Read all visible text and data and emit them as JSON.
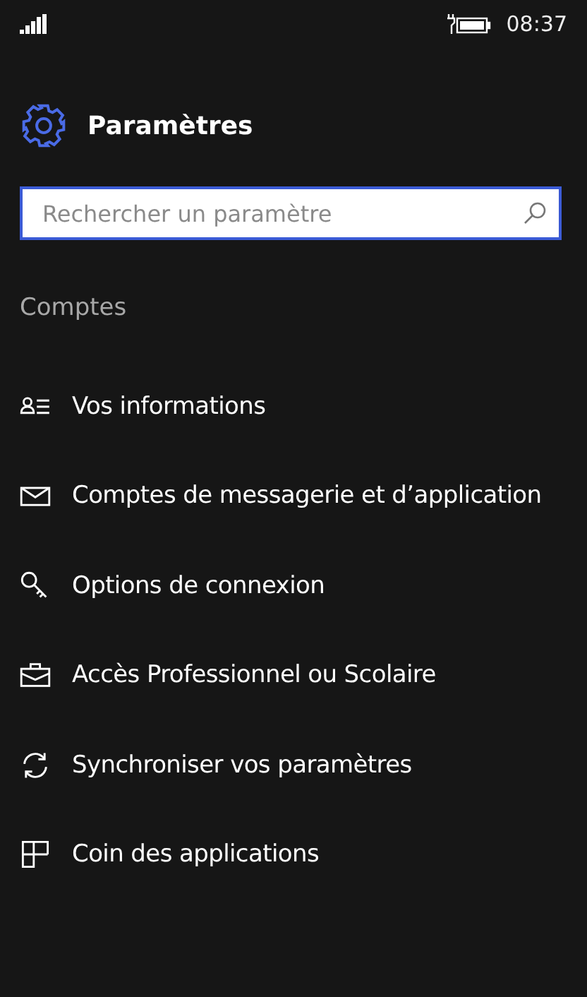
{
  "status_bar": {
    "time": "08:37"
  },
  "header": {
    "title": "Paramètres"
  },
  "search": {
    "placeholder": "Rechercher un paramètre"
  },
  "section": {
    "title": "Comptes"
  },
  "items": [
    {
      "kind": "person",
      "label": "Vos informations"
    },
    {
      "kind": "mail",
      "label": "Comptes de messagerie et d’application"
    },
    {
      "kind": "key",
      "label": "Options de connexion"
    },
    {
      "kind": "briefcase",
      "label": "Accès Professionnel ou Scolaire"
    },
    {
      "kind": "sync",
      "label": "Synchroniser vos paramètres"
    },
    {
      "kind": "apps",
      "label": "Coin des applications"
    }
  ]
}
